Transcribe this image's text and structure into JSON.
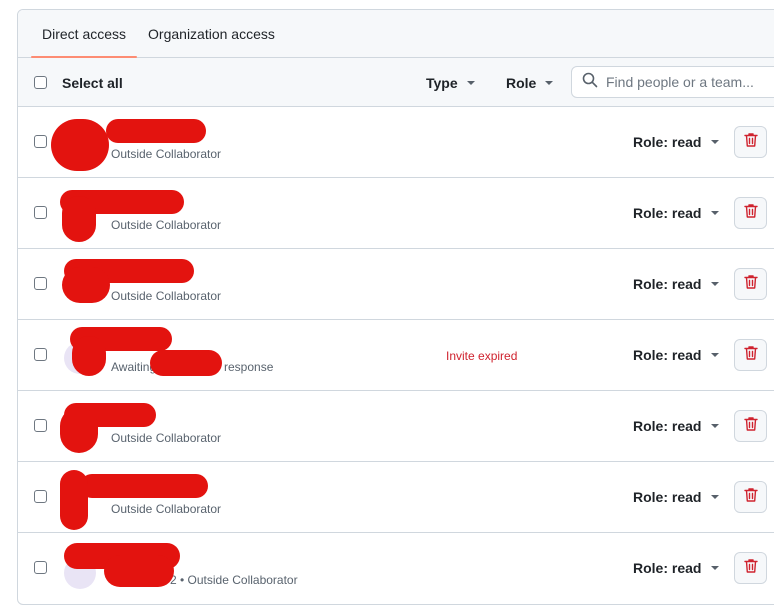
{
  "tabs": [
    {
      "label": "Direct access",
      "active": true
    },
    {
      "label": "Organization access",
      "active": false
    }
  ],
  "toolbar": {
    "select_all_label": "Select all",
    "type_filter_label": "Type",
    "role_filter_label": "Role",
    "search_placeholder": "Find people or a team..."
  },
  "members": [
    {
      "subtitle": "Outside Collaborator",
      "status": "",
      "role": "Role: read"
    },
    {
      "subtitle": "Outside Collaborator",
      "status": "",
      "role": "Role: read"
    },
    {
      "subtitle": "Outside Collaborator",
      "status": "",
      "role": "Role: read"
    },
    {
      "subtitle_left": "Awaiting",
      "subtitle_right": "response",
      "status": "Invite expired",
      "role": "Role: read"
    },
    {
      "subtitle": "Outside Collaborator",
      "status": "",
      "role": "Role: read"
    },
    {
      "subtitle": "Outside Collaborator",
      "status": "",
      "role": "Role: read"
    },
    {
      "subtitle": "2 • Outside Collaborator",
      "status": "",
      "role": "Role: read"
    }
  ],
  "icons": {
    "search": "search-icon",
    "delete": "trash-icon",
    "dropdown": "triangle-down-icon"
  },
  "colors": {
    "tab_underline": "#fd8c73",
    "danger": "#cf222e",
    "redaction": "#e3130f",
    "border": "#d0d7de",
    "header_bg": "#f6f8fa"
  }
}
